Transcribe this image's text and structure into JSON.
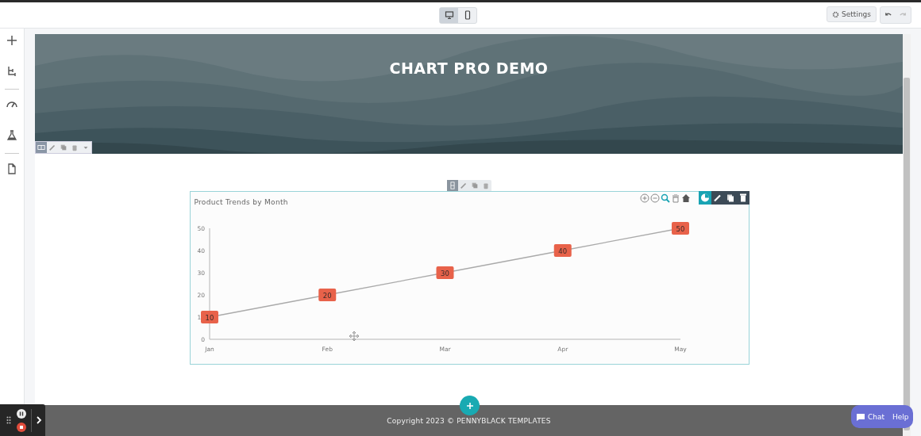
{
  "toolbar": {
    "devices": [
      {
        "kind": "desktop",
        "selected": true
      },
      {
        "kind": "mobile",
        "selected": false
      }
    ],
    "settings": "Settings"
  },
  "hero": {
    "title": "CHART PRO DEMO"
  },
  "chart": {
    "chart_data": {
      "type": "line",
      "title": "Product Trends by Month",
      "categories": [
        "Jan",
        "Feb",
        "Mar",
        "Apr",
        "May"
      ],
      "series": [
        {
          "color": "#aaaaaa",
          "marker": "square",
          "values": [
            10,
            20,
            30,
            40,
            50
          ]
        }
      ],
      "ylim": [
        0,
        50
      ],
      "yticks": [
        0,
        10,
        20,
        30,
        40,
        50
      ],
      "data_labels": true
    }
  },
  "footer": {
    "copyright": "Copyright 2023 © PENNYBLACK TEMPLATES"
  },
  "chat": {
    "chat": "Chat",
    "help": "Help"
  }
}
